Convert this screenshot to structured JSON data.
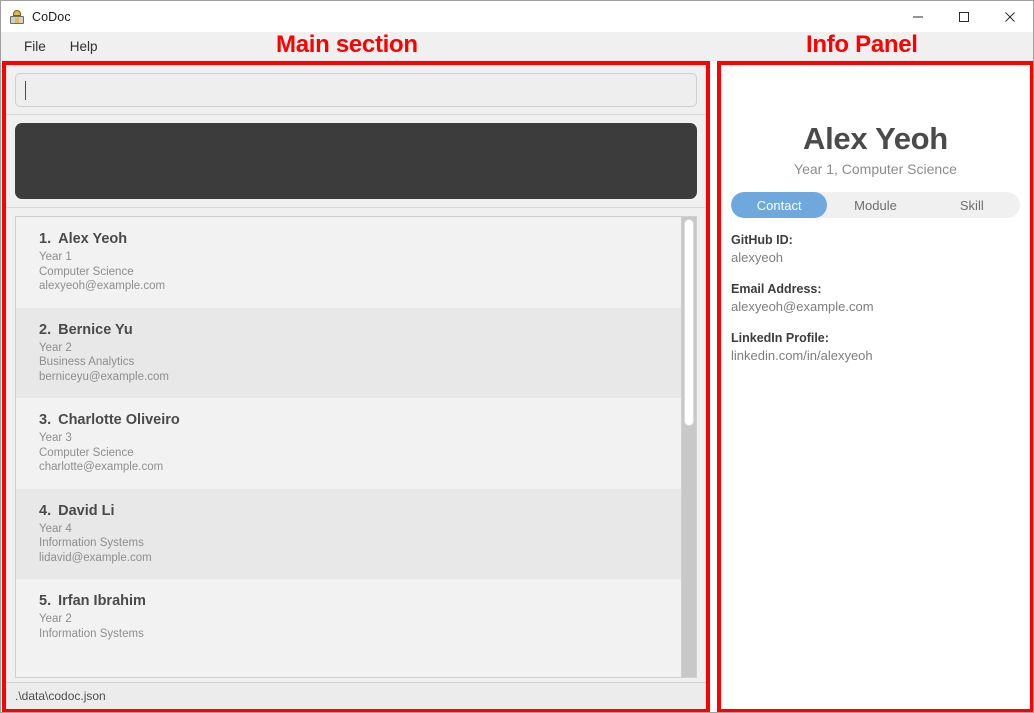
{
  "window": {
    "title": "CoDoc",
    "icon": "app-person-icon",
    "controls": {
      "minimize": "minimize-icon",
      "maximize": "maximize-icon",
      "close": "close-icon"
    }
  },
  "menubar": {
    "items": [
      {
        "label": "File"
      },
      {
        "label": "Help"
      }
    ]
  },
  "annotations": {
    "main_section": "Main section",
    "info_panel": "Info Panel",
    "color": "#ff0000"
  },
  "main": {
    "command_box": {
      "value": "",
      "placeholder": ""
    },
    "result_box": {
      "text": "",
      "background": "#3c3c3c"
    },
    "list": {
      "scroll_thumb_percent": 45,
      "items": [
        {
          "index": "1.",
          "name": "Alex Yeoh",
          "year": "Year 1",
          "major": "Computer Science",
          "email": "alexyeoh@example.com"
        },
        {
          "index": "2.",
          "name": "Bernice Yu",
          "year": "Year 2",
          "major": "Business Analytics",
          "email": "berniceyu@example.com"
        },
        {
          "index": "3.",
          "name": "Charlotte Oliveiro",
          "year": "Year 3",
          "major": "Computer Science",
          "email": "charlotte@example.com"
        },
        {
          "index": "4.",
          "name": "David Li",
          "year": "Year 4",
          "major": "Information Systems",
          "email": "lidavid@example.com"
        },
        {
          "index": "5.",
          "name": "Irfan Ibrahim",
          "year": "Year 2",
          "major": "Information Systems",
          "email": ""
        }
      ]
    },
    "statusbar": {
      "path": ".\\data\\codoc.json"
    }
  },
  "info": {
    "name": "Alex Yeoh",
    "subtitle": "Year 1, Computer Science",
    "tabs": [
      {
        "label": "Contact",
        "active": true
      },
      {
        "label": "Module",
        "active": false
      },
      {
        "label": "Skill",
        "active": false
      }
    ],
    "active_tab_color": "#6fa8dc",
    "fields": [
      {
        "label": "GitHub ID:",
        "value": "alexyeoh"
      },
      {
        "label": "Email Address:",
        "value": "alexyeoh@example.com"
      },
      {
        "label": "LinkedIn Profile:",
        "value": "linkedin.com/in/alexyeoh"
      }
    ]
  }
}
